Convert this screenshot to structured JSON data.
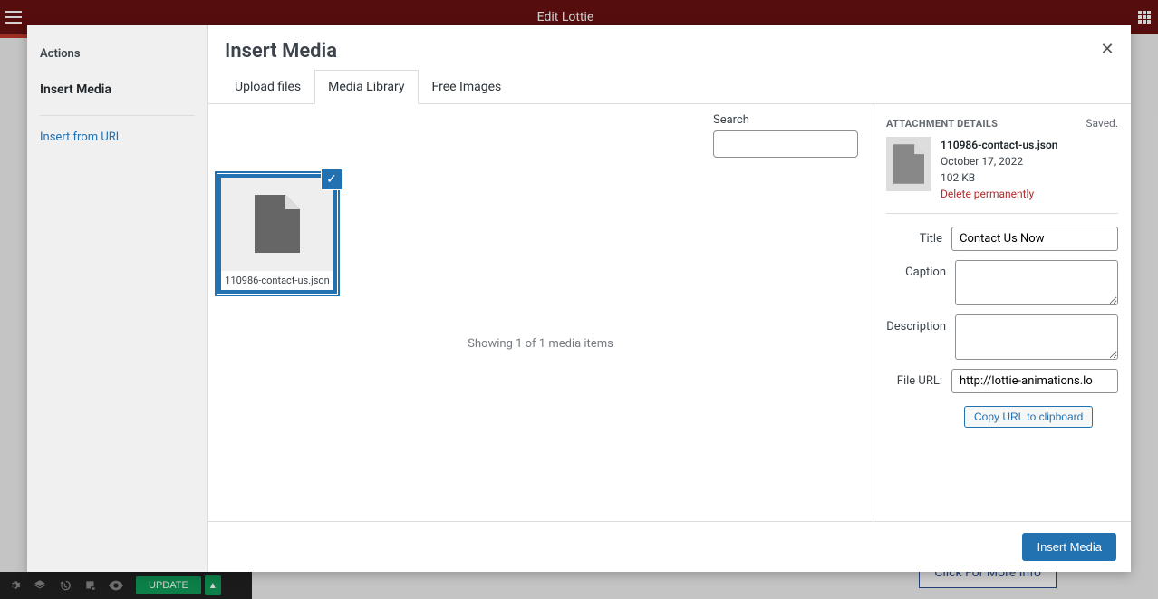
{
  "topbar": {
    "title": "Edit Lottie"
  },
  "bg": {
    "update_label": "UPDATE",
    "more_info": "Click For More Info"
  },
  "sidebar": {
    "heading": "Actions",
    "insert_media": "Insert Media",
    "insert_url": "Insert from URL"
  },
  "modal": {
    "title": "Insert Media",
    "tabs": {
      "upload": "Upload files",
      "library": "Media Library",
      "free": "Free Images"
    },
    "search_label": "Search",
    "showing": "Showing 1 of 1 media items",
    "footer_button": "Insert Media"
  },
  "thumb": {
    "filename": "110986-contact-us.json"
  },
  "details": {
    "heading": "ATTACHMENT DETAILS",
    "saved": "Saved.",
    "filename": "110986-contact-us.json",
    "date": "October 17, 2022",
    "size": "102 KB",
    "delete": "Delete permanently",
    "title_label": "Title",
    "title_value": "Contact Us Now",
    "caption_label": "Caption",
    "caption_value": "",
    "description_label": "Description",
    "description_value": "",
    "fileurl_label": "File URL:",
    "fileurl_value": "http://lottie-animations.lo",
    "copy_label": "Copy URL to clipboard"
  }
}
